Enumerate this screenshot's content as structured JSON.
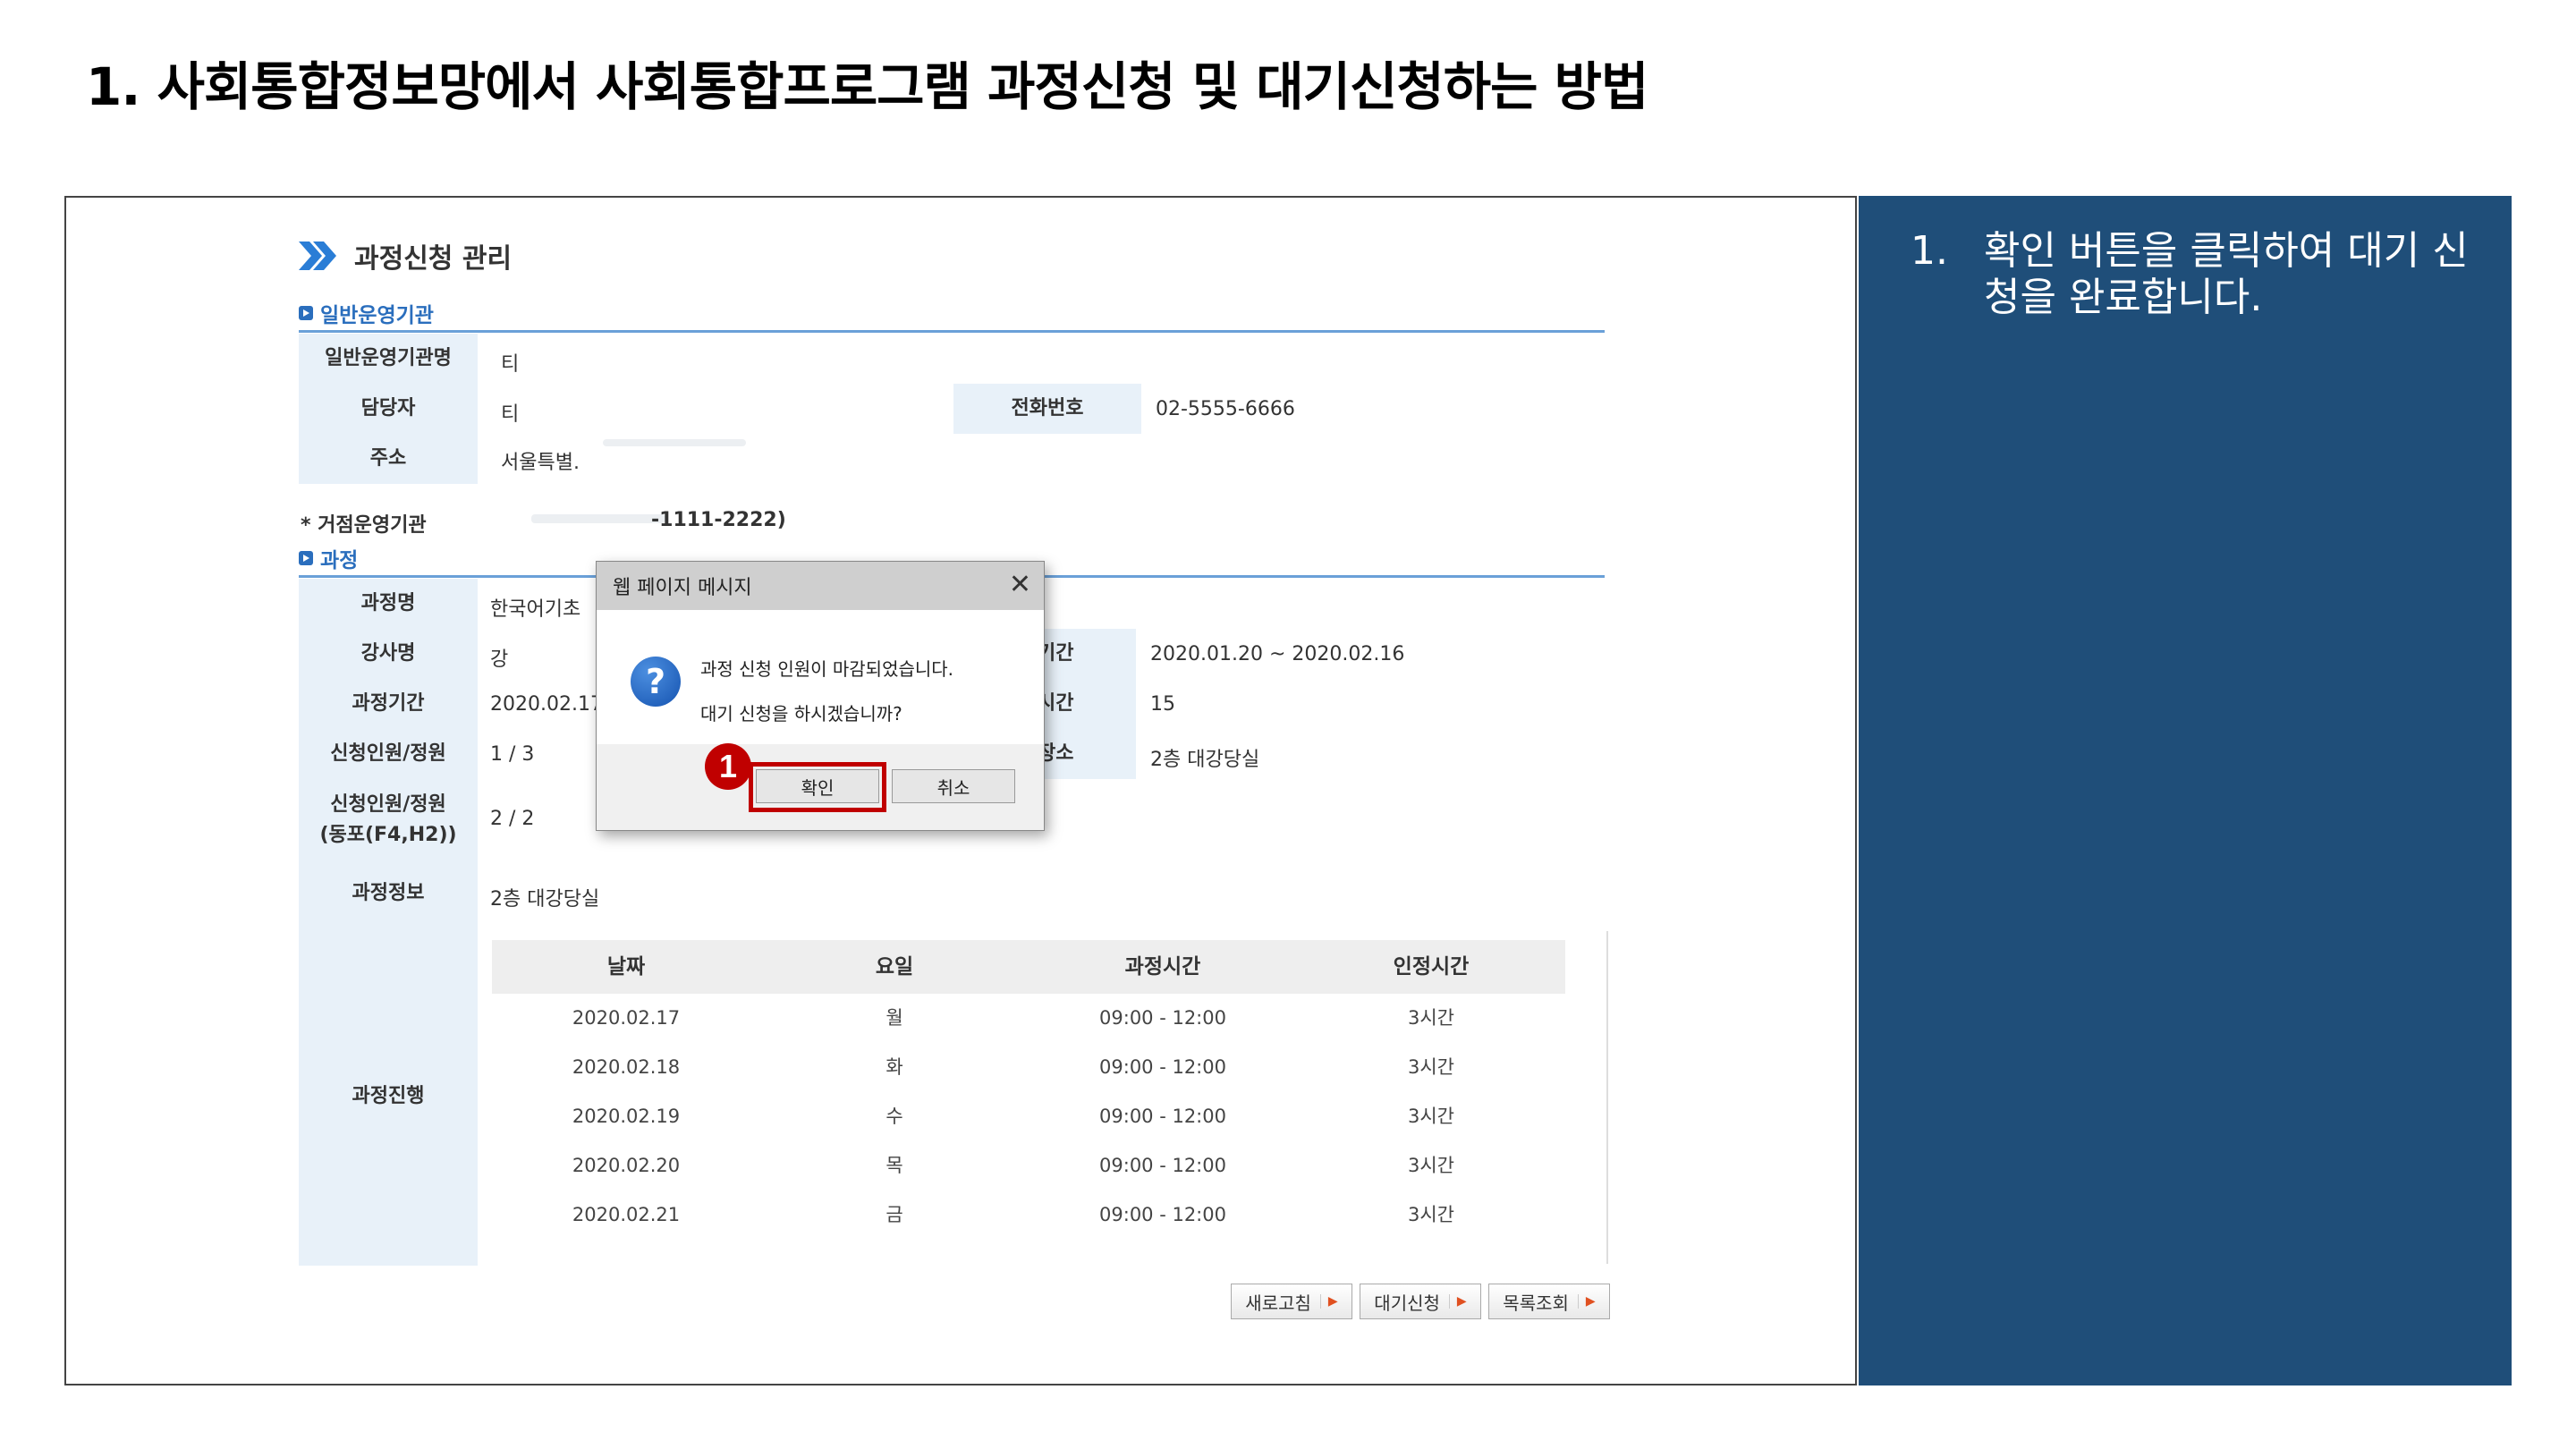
{
  "slide": {
    "title": "1. 사회통합정보망에서 사회통합프로그램 과정신청 및 대기신청하는 방법",
    "instruction_number": "1.",
    "instruction_text": "확인 버튼을 클릭하여 대기 신청을 완료합니다.",
    "sidebar_color": "#1f4e79"
  },
  "page": {
    "header_title": "과정신청 관리",
    "section_general": "일반운영기관",
    "section_course": "과정",
    "hub_note": "* 거점운영기관",
    "hub_phone_tail": "-1111-2222)"
  },
  "general": {
    "org_name_label": "일반운영기관명",
    "org_name": "티",
    "manager_label": "담당자",
    "manager": "티",
    "phone_label": "전화번호",
    "phone": "02-5555-6666",
    "address_label": "주소",
    "address": "서울특별."
  },
  "course": {
    "name_label": "과정명",
    "name": "한국어기초",
    "instructor_label": "강사명",
    "instructor": "강",
    "period_label": "과정기간",
    "period": "2020.02.17",
    "apply_count_label": "신청인원/정원",
    "apply_count": "1 / 3",
    "apply_count_f4_label1": "신청인원/정원",
    "apply_count_f4_label2": "(동포(F4,H2))",
    "apply_count_f4": "2 / 2",
    "apply_period_label": "기간",
    "apply_period": "2020.01.20 ~ 2020.02.16",
    "hours_label": "시간",
    "hours": "15",
    "place_label": "장소",
    "place": "2층 대강당실",
    "info_label": "과정정보",
    "info": "2층 대강당실",
    "progress_label": "과정진행"
  },
  "schedule": {
    "headers": [
      "날짜",
      "요일",
      "과정시간",
      "인정시간"
    ],
    "rows": [
      [
        "2020.02.17",
        "월",
        "09:00 - 12:00",
        "3시간"
      ],
      [
        "2020.02.18",
        "화",
        "09:00 - 12:00",
        "3시간"
      ],
      [
        "2020.02.19",
        "수",
        "09:00 - 12:00",
        "3시간"
      ],
      [
        "2020.02.20",
        "목",
        "09:00 - 12:00",
        "3시간"
      ],
      [
        "2020.02.21",
        "금",
        "09:00 - 12:00",
        "3시간"
      ]
    ]
  },
  "buttons": {
    "refresh": "새로고침",
    "waitlist": "대기신청",
    "list": "목록조회"
  },
  "dialog": {
    "title": "웹 페이지 메시지",
    "close": "✕",
    "icon": "?",
    "message1": "과정 신청 인원이 마감되었습니다.",
    "message2": "대기 신청을 하시겠습니까?",
    "ok": "확인",
    "cancel": "취소",
    "step_badge": "1",
    "highlight_color": "#c00000"
  }
}
